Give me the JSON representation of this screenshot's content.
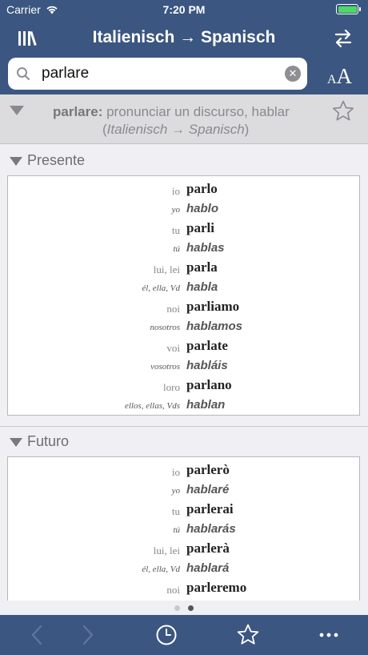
{
  "status_bar": {
    "carrier": "Carrier",
    "time": "7:20 PM"
  },
  "nav": {
    "title": "Italienisch → Spanisch"
  },
  "search": {
    "query": "parlare",
    "font_size_small": "A",
    "font_size_big": "A"
  },
  "entry": {
    "headword": "parlare",
    "definition": " pronunciar un discurso, hablar",
    "direction": "(Italienisch → Spanisch)"
  },
  "sections": [
    {
      "title": "Presente",
      "rows": [
        {
          "it_pronoun": "io",
          "it_verb": "parlo",
          "es_pronoun": "yo",
          "es_verb": "hablo"
        },
        {
          "it_pronoun": "tu",
          "it_verb": "parli",
          "es_pronoun": "tú",
          "es_verb": "hablas"
        },
        {
          "it_pronoun": "lui, lei",
          "it_verb": "parla",
          "es_pronoun": "él, ella, Vd",
          "es_verb": "habla"
        },
        {
          "it_pronoun": "noi",
          "it_verb": "parliamo",
          "es_pronoun": "nosotros",
          "es_verb": "hablamos"
        },
        {
          "it_pronoun": "voi",
          "it_verb": "parlate",
          "es_pronoun": "vosotros",
          "es_verb": "habláis"
        },
        {
          "it_pronoun": "loro",
          "it_verb": "parlano",
          "es_pronoun": "ellos, ellas, Vds",
          "es_verb": "hablan"
        }
      ]
    },
    {
      "title": "Futuro",
      "rows": [
        {
          "it_pronoun": "io",
          "it_verb": "parlerò",
          "es_pronoun": "yo",
          "es_verb": "hablaré"
        },
        {
          "it_pronoun": "tu",
          "it_verb": "parlerai",
          "es_pronoun": "tú",
          "es_verb": "hablarás"
        },
        {
          "it_pronoun": "lui, lei",
          "it_verb": "parlerà",
          "es_pronoun": "él, ella, Vd",
          "es_verb": "hablará"
        },
        {
          "it_pronoun": "noi",
          "it_verb": "parleremo",
          "es_pronoun": "",
          "es_verb": ""
        }
      ]
    }
  ],
  "page_indicator": {
    "current": 2,
    "total": 2
  },
  "colors": {
    "nav_bg": "#3b5680",
    "content_bg": "#efeff4",
    "battery": "#4cd964"
  },
  "icons": [
    "wifi-icon",
    "battery-icon",
    "library-icon",
    "swap-direction-icon",
    "search-icon",
    "clear-icon",
    "star-icon",
    "back-icon",
    "forward-icon",
    "history-icon",
    "favorites-icon",
    "more-icon"
  ]
}
